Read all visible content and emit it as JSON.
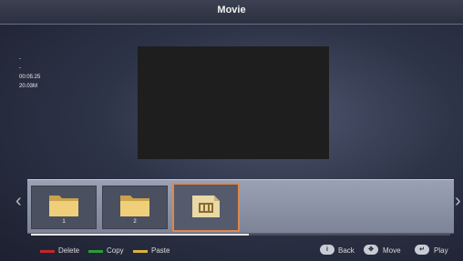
{
  "header": {
    "title": "Movie"
  },
  "info": {
    "lines": [
      "-",
      "-",
      "00:05:25",
      "20.03M"
    ]
  },
  "files": [
    {
      "label": "1",
      "type": "folder"
    },
    {
      "label": "2",
      "type": "folder"
    },
    {
      "label": "",
      "type": "movie"
    }
  ],
  "progress": {
    "fraction": 0.52
  },
  "footer": {
    "delete_label": "Delete",
    "copy_label": "Copy",
    "paste_label": "Paste",
    "back_label": "Back",
    "move_label": "Move",
    "play_label": "Play"
  },
  "colors": {
    "delete": "#c0272d",
    "copy": "#2e9b3a",
    "paste": "#d8b33a",
    "selection": "#e0874a"
  },
  "icons": {
    "left": "chevron-left-icon",
    "right": "chevron-right-icon",
    "folder": "folder-icon",
    "movie": "movie-file-icon"
  }
}
